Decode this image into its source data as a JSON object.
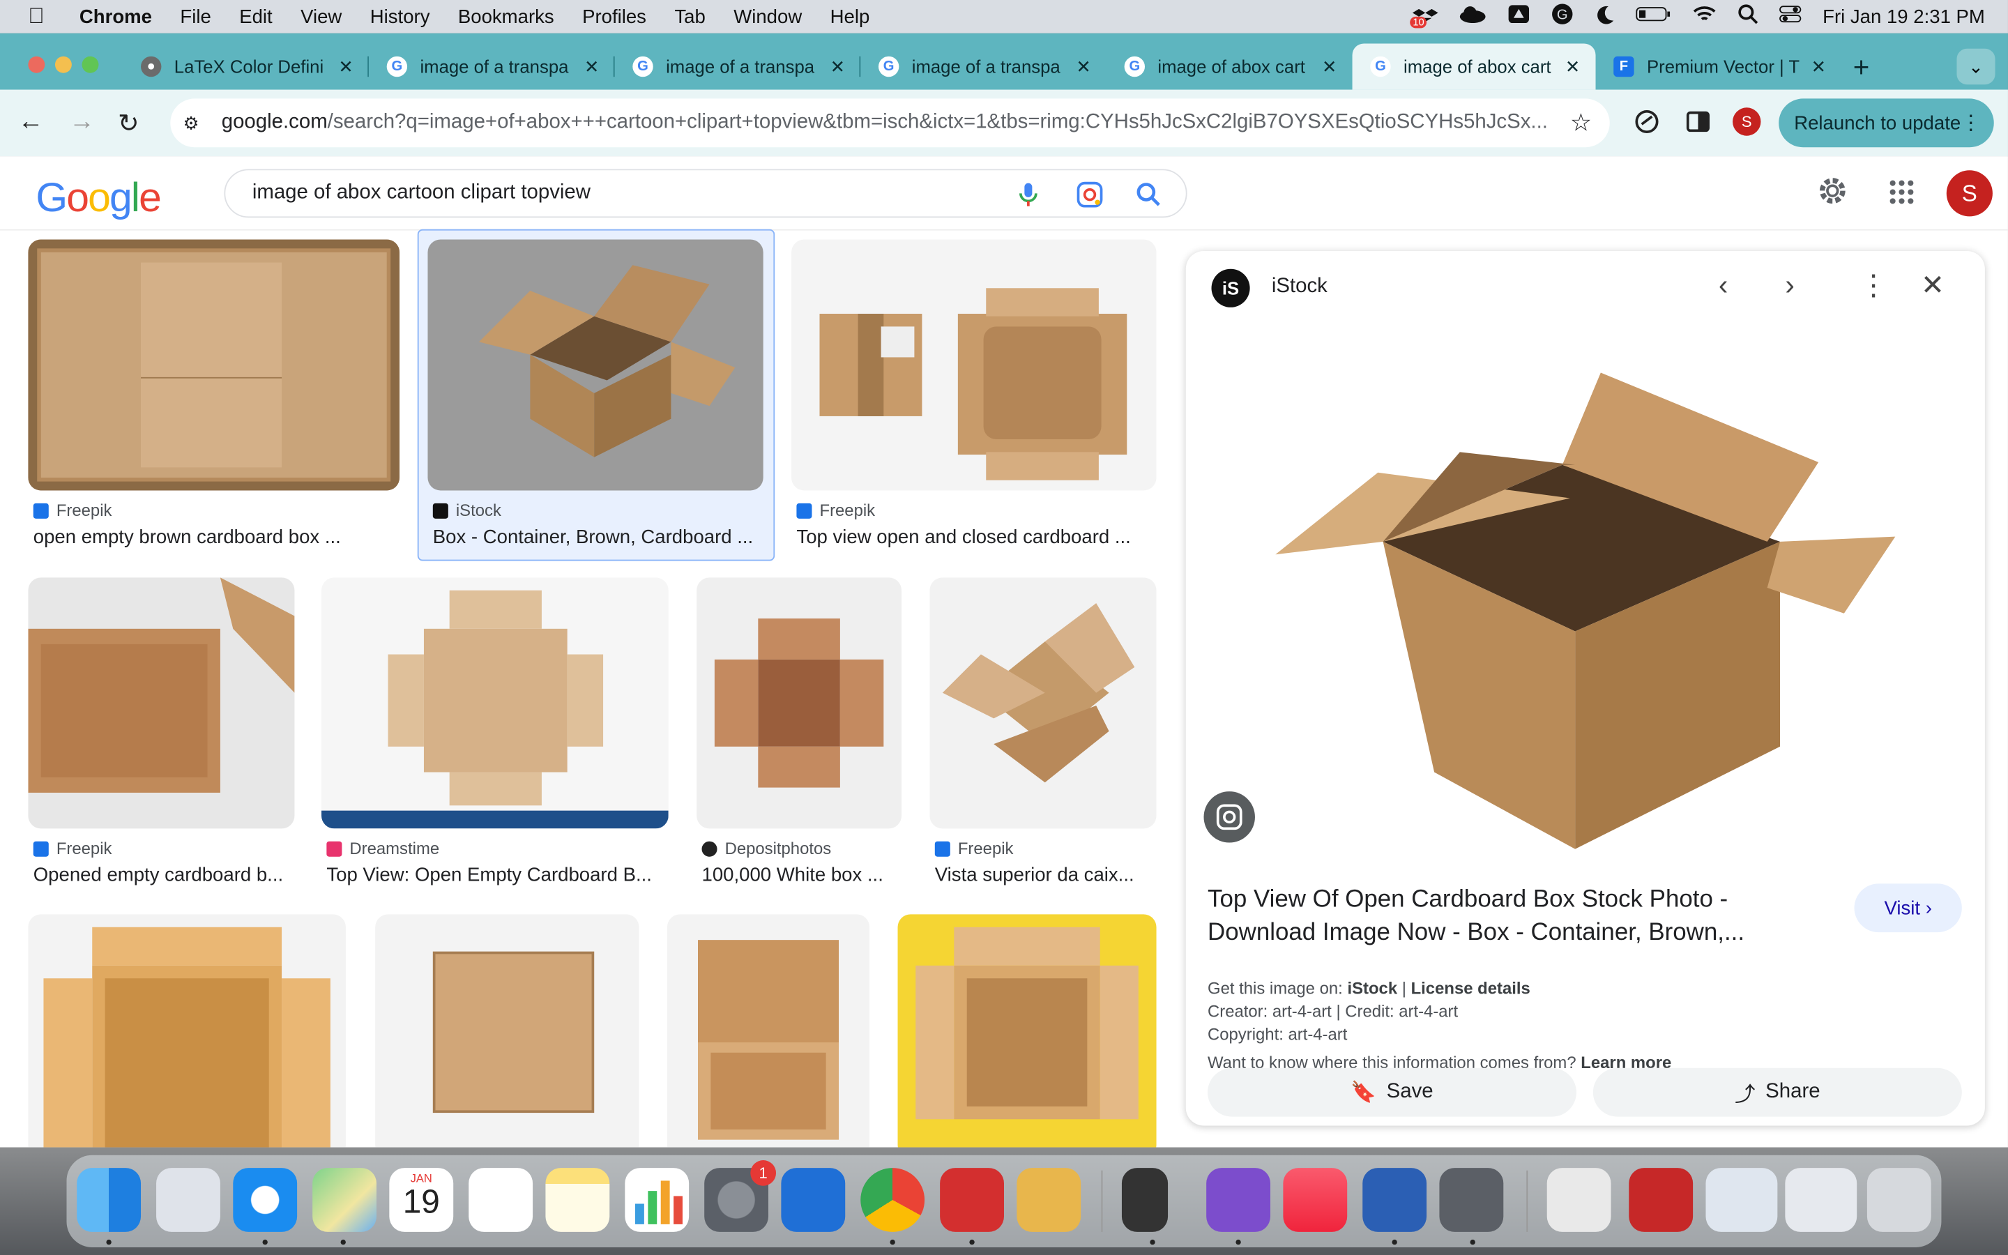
{
  "menubar": {
    "app_name": "Chrome",
    "menus": [
      "File",
      "Edit",
      "View",
      "History",
      "Bookmarks",
      "Profiles",
      "Tab",
      "Window",
      "Help"
    ],
    "datetime": "Fri Jan 19  2:31 PM",
    "badge_count": "10"
  },
  "tabs": [
    {
      "title": "LaTeX Color Defini",
      "favicon": "globe-icon"
    },
    {
      "title": "image of a transpa",
      "favicon": "google-icon"
    },
    {
      "title": "image of a transpa",
      "favicon": "google-icon"
    },
    {
      "title": "image of a transpa",
      "favicon": "google-icon"
    },
    {
      "title": "image of abox cart",
      "favicon": "google-icon"
    },
    {
      "title": "image of abox cart",
      "favicon": "google-icon",
      "active": true
    },
    {
      "title": "Premium Vector | T",
      "favicon": "freepik-icon"
    }
  ],
  "toolbar": {
    "url_host": "google.com",
    "url_path": "/search?q=image+of+abox+++cartoon+clipart+topview&tbm=isch&ictx=1&tbs=rimg:CYHs5hJcSxC2lgiB7OYSXEsQtioSCYHs5hJcSx...",
    "profile_initial": "S",
    "relaunch_label": "Relaunch to update"
  },
  "google": {
    "logo_text": "Google",
    "query": "image of abox   cartoon clipart topview",
    "avatar_initial": "S"
  },
  "results": [
    {
      "source": "Freepik",
      "caption": "open empty brown cardboard box ...",
      "color": "#1a73e8"
    },
    {
      "source": "iStock",
      "caption": "Box - Container, Brown, Cardboard ...",
      "color": "#111111"
    },
    {
      "source": "Freepik",
      "caption": "Top view open and closed cardboard ...",
      "color": "#1a73e8"
    },
    {
      "source": "Freepik",
      "caption": "Opened empty cardboard b...",
      "color": "#1a73e8"
    },
    {
      "source": "Dreamstime",
      "caption": "Top View: Open Empty Cardboard B...",
      "color": "#e8336d"
    },
    {
      "source": "Depositphotos",
      "caption": "100,000 White box ...",
      "color": "#222222"
    },
    {
      "source": "Freepik",
      "caption": "Vista superior da caix...",
      "color": "#1a73e8"
    }
  ],
  "panel": {
    "source": "iStock",
    "title": "Top View Of Open Cardboard Box Stock Photo - Download Image Now - Box - Container, Brown,...",
    "visit_label": "Visit",
    "get_image_label": "Get this image on:",
    "get_image_source": "iStock",
    "license_label": "License details",
    "creator": "Creator: art-4-art | Credit: art-4-art",
    "copyright": "Copyright: art-4-art",
    "info_question": "Want to know where this information comes from?",
    "learn_more": "Learn more",
    "save_label": "Save",
    "share_label": "Share"
  },
  "dock": {
    "calendar_month": "JAN",
    "calendar_day": "19",
    "settings_badge": "1"
  }
}
